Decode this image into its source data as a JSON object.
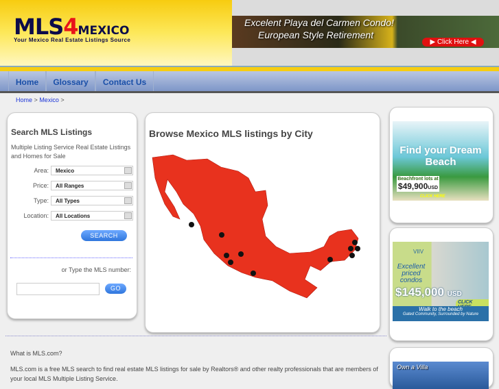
{
  "header": {
    "logo_main": "MLS",
    "logo_four": "4",
    "logo_mexico": "MEXICO",
    "logo_tagline": "Your Mexico Real Estate Listings Source",
    "ad": {
      "line1": "Excelent Playa del Carmen Condo!",
      "line2": "European Style Retirement",
      "button": "Click Here"
    }
  },
  "nav": [
    {
      "label": "Home"
    },
    {
      "label": "Glossary"
    },
    {
      "label": "Contact Us"
    }
  ],
  "breadcrumb": {
    "home": "Home",
    "sep": ">",
    "mexico": "Mexico"
  },
  "search": {
    "title": "Search MLS Listings",
    "description": "Multiple Listing Service Real Estate Listings and Homes for Sale",
    "fields": [
      {
        "label": "Area:",
        "value": "Mexico"
      },
      {
        "label": "Price:",
        "value": "All Ranges"
      },
      {
        "label": "Type:",
        "value": "All Types"
      },
      {
        "label": "Location:",
        "value": "All Locations"
      }
    ],
    "search_button": "SEARCH",
    "mls_prompt": "or Type the MLS number:",
    "mls_value": "",
    "go_button": "GO"
  },
  "center": {
    "title": "Browse Mexico MLS listings by City",
    "map_color": "#e8321e"
  },
  "ads": {
    "ad1": {
      "headline": "Find your Dream Beach",
      "sub": "Beachfront lots at",
      "price": "$49,900",
      "currency": "USD",
      "cta": "CLICK HERE"
    },
    "ad2": {
      "brand": "VIIV",
      "headline": "Excellent priced condos",
      "price": "$145,000",
      "currency": "USD",
      "cta": "CLICK HERE",
      "line1": "Walk to the beach",
      "line2": "Gated Community, Surrounded by Nature"
    },
    "ad3": {
      "headline": "Own a Villa"
    }
  },
  "footer": {
    "question": "What is MLS.com?",
    "paragraph": "MLS.com is a free MLS search to find real estate MLS listings for sale by Realtors® and other realty professionals that are members of your local MLS Multiple Listing Service."
  }
}
